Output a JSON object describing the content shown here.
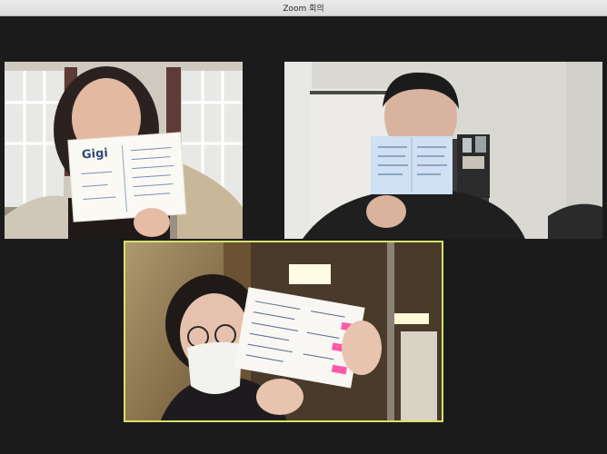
{
  "window": {
    "title": "Zoom 회의"
  },
  "participants": [
    {
      "card_name": "Gigi",
      "speaking": false
    },
    {
      "speaking": false
    },
    {
      "speaking": true,
      "highlight_color": "#d6e26a"
    }
  ]
}
